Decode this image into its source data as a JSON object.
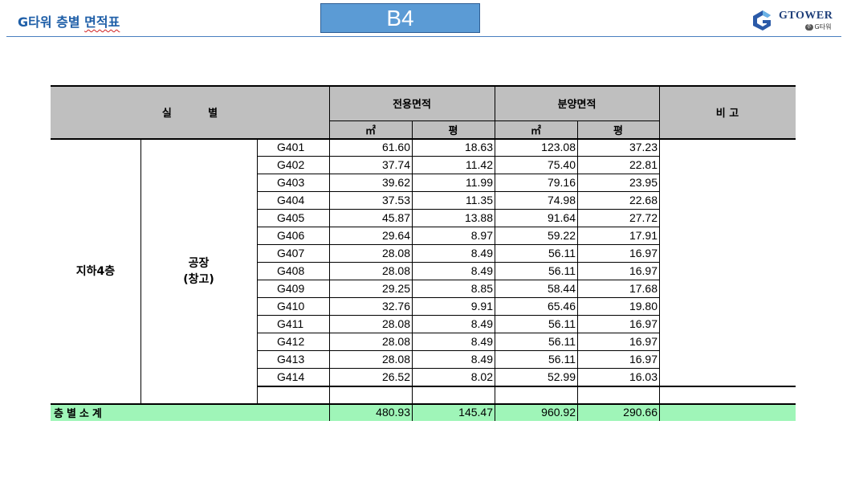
{
  "header": {
    "title_prefix": "G타워 층별 ",
    "title_squiggle": "면적표",
    "floor_badge": "B4",
    "logo_name": "GTOWER",
    "logo_badge": "주",
    "logo_sub": "G타워"
  },
  "table": {
    "col_room": "실          별",
    "col_exclusive": "전용면적",
    "col_sale": "분양면적",
    "col_note": "비  고",
    "unit_m2": "㎡",
    "unit_pyeong": "평",
    "floor_label": "지하4층",
    "usage_line1": "공장",
    "usage_line2": "(창고)",
    "rows": [
      {
        "code": "G401",
        "m2": "61.60",
        "py": "18.63",
        "sale_m2": "123.08",
        "sale_py": "37.23"
      },
      {
        "code": "G402",
        "m2": "37.74",
        "py": "11.42",
        "sale_m2": "75.40",
        "sale_py": "22.81"
      },
      {
        "code": "G403",
        "m2": "39.62",
        "py": "11.99",
        "sale_m2": "79.16",
        "sale_py": "23.95"
      },
      {
        "code": "G404",
        "m2": "37.53",
        "py": "11.35",
        "sale_m2": "74.98",
        "sale_py": "22.68"
      },
      {
        "code": "G405",
        "m2": "45.87",
        "py": "13.88",
        "sale_m2": "91.64",
        "sale_py": "27.72"
      },
      {
        "code": "G406",
        "m2": "29.64",
        "py": "8.97",
        "sale_m2": "59.22",
        "sale_py": "17.91"
      },
      {
        "code": "G407",
        "m2": "28.08",
        "py": "8.49",
        "sale_m2": "56.11",
        "sale_py": "16.97"
      },
      {
        "code": "G408",
        "m2": "28.08",
        "py": "8.49",
        "sale_m2": "56.11",
        "sale_py": "16.97"
      },
      {
        "code": "G409",
        "m2": "29.25",
        "py": "8.85",
        "sale_m2": "58.44",
        "sale_py": "17.68"
      },
      {
        "code": "G410",
        "m2": "32.76",
        "py": "9.91",
        "sale_m2": "65.46",
        "sale_py": "19.80"
      },
      {
        "code": "G411",
        "m2": "28.08",
        "py": "8.49",
        "sale_m2": "56.11",
        "sale_py": "16.97"
      },
      {
        "code": "G412",
        "m2": "28.08",
        "py": "8.49",
        "sale_m2": "56.11",
        "sale_py": "16.97"
      },
      {
        "code": "G413",
        "m2": "28.08",
        "py": "8.49",
        "sale_m2": "56.11",
        "sale_py": "16.97"
      },
      {
        "code": "G414",
        "m2": "26.52",
        "py": "8.02",
        "sale_m2": "52.99",
        "sale_py": "16.03"
      }
    ],
    "subtotal": {
      "label": "층별소계",
      "m2": "480.93",
      "py": "145.47",
      "sale_m2": "960.92",
      "sale_py": "290.66"
    }
  },
  "colors": {
    "title": "#1f5fa8",
    "badge": "#5b9bd5",
    "header_gray": "#bfbfbf",
    "subtotal_green": "#9ff5b8"
  }
}
